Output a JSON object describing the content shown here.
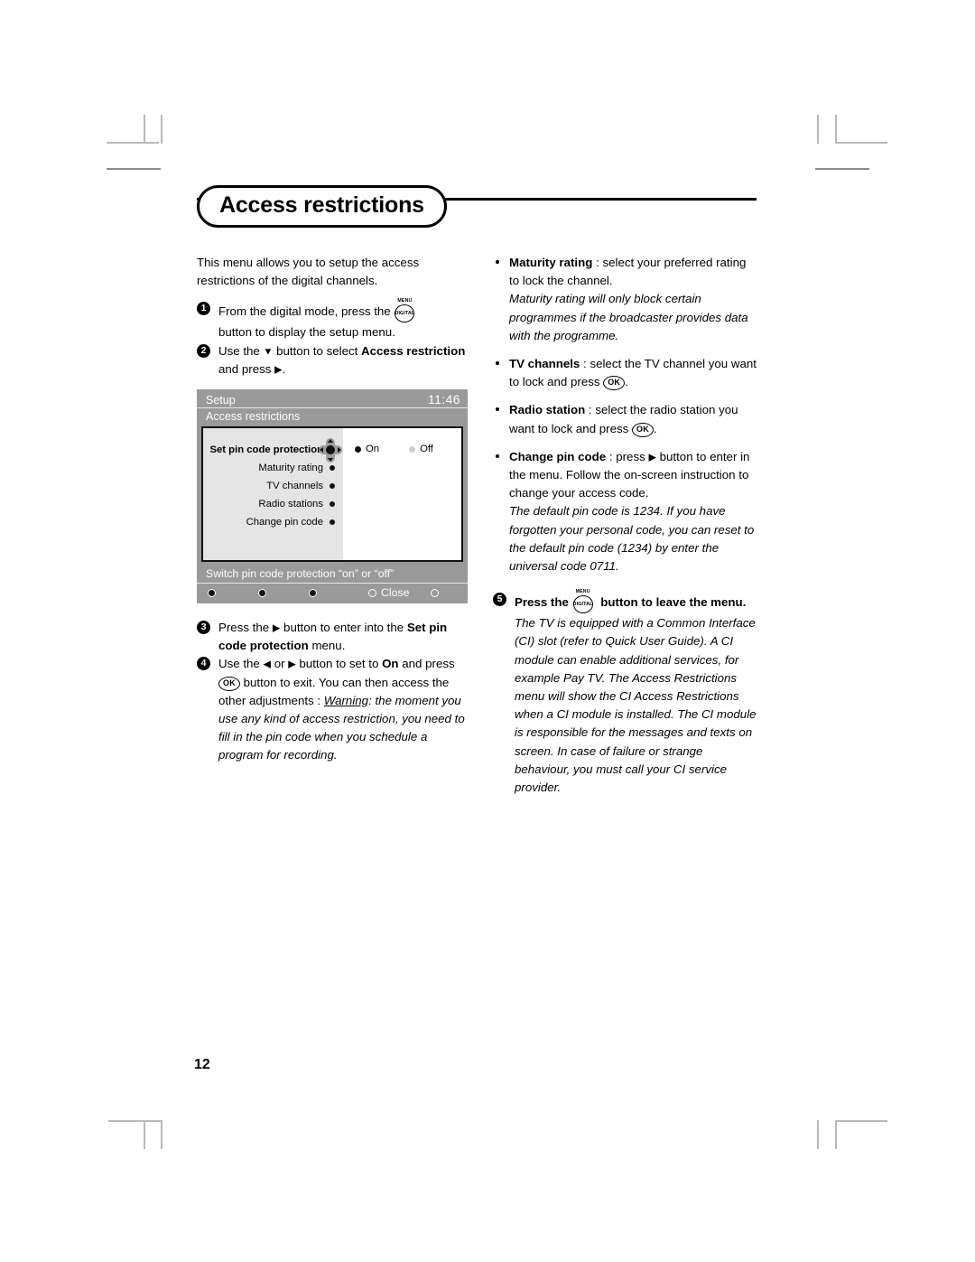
{
  "page": {
    "title": "Access restrictions",
    "number": "12"
  },
  "left": {
    "intro": "This menu allows you to setup the access restrictions of the digital channels.",
    "step1": {
      "num": "1",
      "before": "From the digital mode, press the",
      "icon": "menu-digital-button",
      "after": "button to display the setup menu."
    },
    "step2": {
      "num": "2",
      "a": "Use the",
      "arrow_down": "▼",
      "b": "button to select",
      "bold": "Access restriction",
      "c": "and press",
      "arrow_right": "▶",
      "d": "."
    },
    "step3": {
      "num": "3",
      "a": "Press the",
      "arrow_right": "▶",
      "b": "button to enter into the",
      "bold": "Set pin code protection",
      "c": "menu."
    },
    "step4": {
      "num": "4",
      "a": "Use the",
      "arrow_left": "◀",
      "or": "or",
      "arrow_right": "▶",
      "b": "button to set to",
      "bold_on": "On",
      "c": "and press",
      "ok": "OK",
      "d": "button to exit. You can then access the other adjustments :",
      "warning_label": "Warning",
      "warning_colon": ":",
      "warning_text": "the moment you use any kind of access restriction, you need to fill in the pin code when you schedule a program for recording."
    }
  },
  "tv": {
    "header_left": "Setup",
    "header_time": "11:46",
    "subheader": "Access restrictions",
    "menu_items": [
      {
        "label": "Set pin code protection",
        "selected": true
      },
      {
        "label": "Maturity rating",
        "selected": false
      },
      {
        "label": "TV channels",
        "selected": false
      },
      {
        "label": "Radio stations",
        "selected": false
      },
      {
        "label": "Change pin code",
        "selected": false
      }
    ],
    "options": [
      {
        "label": "On",
        "selected": true
      },
      {
        "label": "Off",
        "selected": false
      }
    ],
    "hint": "Switch pin code protection “on” or “off”",
    "keys": [
      {
        "label": "",
        "filled": true
      },
      {
        "label": "",
        "filled": true
      },
      {
        "label": "",
        "filled": true
      },
      {
        "label": "Close",
        "filled": false
      },
      {
        "label": "",
        "filled": false
      }
    ],
    "colors": {
      "chrome": "#9a9a9a",
      "menu_panel": "#e4e4e4",
      "stage": "#ffffff",
      "radio_on": "#111111",
      "radio_off": "#cfcfcf"
    }
  },
  "right": {
    "maturity": {
      "bold": "Maturity rating",
      "colon": ":",
      "text": "select your preferred rating to lock the channel.",
      "italic": "Maturity rating will only block certain programmes if the broadcaster provides data with the programme."
    },
    "tv_channels": {
      "bold": "TV channels",
      "colon": ":",
      "a": "select the TV channel you want to lock and press",
      "ok": "OK",
      "b": "."
    },
    "radio_station": {
      "bold": "Radio station",
      "colon": ":",
      "a": "select the radio station you want to lock and press",
      "ok": "OK",
      "b": "."
    },
    "change_pin": {
      "bold": "Change pin code",
      "colon": ":",
      "a": "press",
      "arrow_right": "▶",
      "b": "button to enter in the menu. Follow the on-screen instruction to change your access code.",
      "italic": "The default pin code is 1234. If you have forgotten your personal code, you can reset to the default pin code (1234) by enter the universal code 0711."
    },
    "step5": {
      "num": "5",
      "a": "Press the",
      "icon": "menu-digital-button",
      "b": "button to leave the menu.",
      "italic": "The TV is equipped with a Common Interface (CI) slot (refer to Quick User Guide). A CI module can enable additional services, for example Pay TV. The Access Restrictions menu will show the CI Access Restrictions when a CI module is installed. The CI module is responsible for the messages and texts on screen. In case of failure or strange behaviour, you must call your CI service provider."
    }
  },
  "icons": {
    "menu_top_label": "MENU",
    "menu_mid_label": "DIGITAL",
    "ok_label": "OK"
  }
}
